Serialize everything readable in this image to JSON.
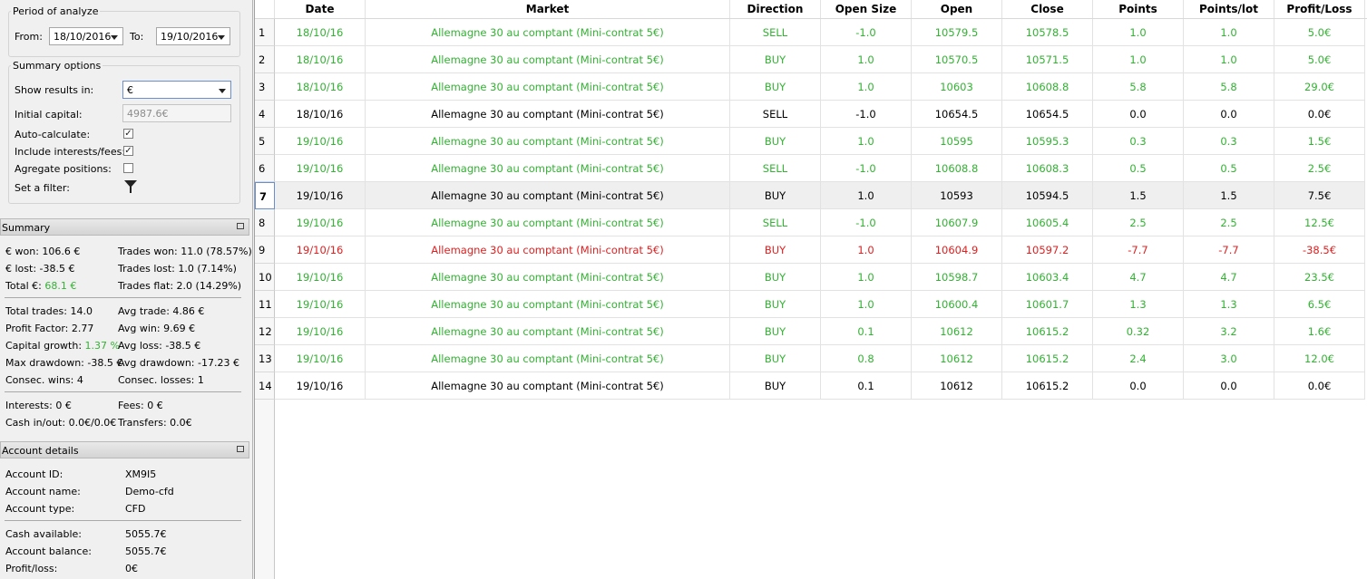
{
  "period": {
    "legend": "Period of analyze",
    "from_label": "From:",
    "from_value": "18/10/2016",
    "to_label": "To:",
    "to_value": "19/10/2016"
  },
  "summary_options": {
    "legend": "Summary options",
    "show_results_label": "Show results in:",
    "show_results_value": "€",
    "initial_capital_label": "Initial capital:",
    "initial_capital_value": "4987.6€",
    "auto_calculate_label": "Auto-calculate:",
    "auto_calculate_checked": true,
    "include_fees_label": "Include interests/fees:",
    "include_fees_checked": true,
    "aggregate_label": "Agregate positions:",
    "aggregate_checked": false,
    "filter_label": "Set a filter:",
    "filter_icon": "funnel-icon",
    "check_mark": "✓"
  },
  "summary": {
    "title": "Summary",
    "won_label": "€ won:",
    "won_value": "106.6 €",
    "lost_label": "€ lost:",
    "lost_value": "-38.5 €",
    "total_label": "Total €:",
    "total_value": "68.1 €",
    "trades_won_label": "Trades won:",
    "trades_won_value": "11.0 (78.57%)",
    "trades_lost_label": "Trades lost:",
    "trades_lost_value": "1.0 (7.14%)",
    "trades_flat_label": "Trades flat:",
    "trades_flat_value": "2.0 (14.29%)",
    "total_trades_label": "Total trades:",
    "total_trades_value": "14.0",
    "profit_factor_label": "Profit Factor:",
    "profit_factor_value": "2.77",
    "capital_growth_label": "Capital growth:",
    "capital_growth_value": "1.37 %",
    "max_drawdown_label": "Max drawdown:",
    "max_drawdown_value": "-38.5 €",
    "consec_wins_label": "Consec. wins:",
    "consec_wins_value": "4",
    "avg_trade_label": "Avg trade:",
    "avg_trade_value": "4.86 €",
    "avg_win_label": "Avg win:",
    "avg_win_value": "9.69 €",
    "avg_loss_label": "Avg loss:",
    "avg_loss_value": "-38.5 €",
    "avg_drawdown_label": "Avg drawdown:",
    "avg_drawdown_value": "-17.23 €",
    "consec_losses_label": "Consec. losses:",
    "consec_losses_value": "1",
    "interests_label": "Interests:",
    "interests_value": "0 €",
    "fees_label": "Fees:",
    "fees_value": "0 €",
    "cash_label": "Cash in/out:",
    "cash_value": "0.0€/0.0€",
    "transfers_label": "Transfers:",
    "transfers_value": "0.0€"
  },
  "account": {
    "title": "Account details",
    "id_label": "Account ID:",
    "id_value": "XM9I5",
    "name_label": "Account name:",
    "name_value": "Demo-cfd",
    "type_label": "Account type:",
    "type_value": "CFD",
    "cash_label": "Cash available:",
    "cash_value": "5055.7€",
    "balance_label": "Account balance:",
    "balance_value": "5055.7€",
    "pl_label": "Profit/loss:",
    "pl_value": "0€"
  },
  "table": {
    "headers": [
      "Date",
      "Market",
      "Direction",
      "Open Size",
      "Open",
      "Close",
      "Points",
      "Points/lot",
      "Profit/Loss"
    ],
    "colors": {
      "green": "#33b233",
      "red": "#e02020",
      "black": "#000000"
    },
    "selected_row": 7,
    "rows": [
      {
        "n": "1",
        "date": "18/10/16",
        "market": "Allemagne 30 au comptant (Mini-contrat 5€)",
        "direction": "SELL",
        "size": "-1.0",
        "open": "10579.5",
        "close": "10578.5",
        "points": "1.0",
        "ppl": "1.0",
        "pl": "5.0€",
        "color": "green"
      },
      {
        "n": "2",
        "date": "18/10/16",
        "market": "Allemagne 30 au comptant (Mini-contrat 5€)",
        "direction": "BUY",
        "size": "1.0",
        "open": "10570.5",
        "close": "10571.5",
        "points": "1.0",
        "ppl": "1.0",
        "pl": "5.0€",
        "color": "green"
      },
      {
        "n": "3",
        "date": "18/10/16",
        "market": "Allemagne 30 au comptant (Mini-contrat 5€)",
        "direction": "BUY",
        "size": "1.0",
        "open": "10603",
        "close": "10608.8",
        "points": "5.8",
        "ppl": "5.8",
        "pl": "29.0€",
        "color": "green"
      },
      {
        "n": "4",
        "date": "18/10/16",
        "market": "Allemagne 30 au comptant (Mini-contrat 5€)",
        "direction": "SELL",
        "size": "-1.0",
        "open": "10654.5",
        "close": "10654.5",
        "points": "0.0",
        "ppl": "0.0",
        "pl": "0.0€",
        "color": "black"
      },
      {
        "n": "5",
        "date": "19/10/16",
        "market": "Allemagne 30 au comptant (Mini-contrat 5€)",
        "direction": "BUY",
        "size": "1.0",
        "open": "10595",
        "close": "10595.3",
        "points": "0.3",
        "ppl": "0.3",
        "pl": "1.5€",
        "color": "green"
      },
      {
        "n": "6",
        "date": "19/10/16",
        "market": "Allemagne 30 au comptant (Mini-contrat 5€)",
        "direction": "SELL",
        "size": "-1.0",
        "open": "10608.8",
        "close": "10608.3",
        "points": "0.5",
        "ppl": "0.5",
        "pl": "2.5€",
        "color": "green"
      },
      {
        "n": "7",
        "date": "19/10/16",
        "market": "Allemagne 30 au comptant (Mini-contrat 5€)",
        "direction": "BUY",
        "size": "1.0",
        "open": "10593",
        "close": "10594.5",
        "points": "1.5",
        "ppl": "1.5",
        "pl": "7.5€",
        "color": "black"
      },
      {
        "n": "8",
        "date": "19/10/16",
        "market": "Allemagne 30 au comptant (Mini-contrat 5€)",
        "direction": "SELL",
        "size": "-1.0",
        "open": "10607.9",
        "close": "10605.4",
        "points": "2.5",
        "ppl": "2.5",
        "pl": "12.5€",
        "color": "green"
      },
      {
        "n": "9",
        "date": "19/10/16",
        "market": "Allemagne 30 au comptant (Mini-contrat 5€)",
        "direction": "BUY",
        "size": "1.0",
        "open": "10604.9",
        "close": "10597.2",
        "points": "-7.7",
        "ppl": "-7.7",
        "pl": "-38.5€",
        "color": "red"
      },
      {
        "n": "10",
        "date": "19/10/16",
        "market": "Allemagne 30 au comptant (Mini-contrat 5€)",
        "direction": "BUY",
        "size": "1.0",
        "open": "10598.7",
        "close": "10603.4",
        "points": "4.7",
        "ppl": "4.7",
        "pl": "23.5€",
        "color": "green"
      },
      {
        "n": "11",
        "date": "19/10/16",
        "market": "Allemagne 30 au comptant (Mini-contrat 5€)",
        "direction": "BUY",
        "size": "1.0",
        "open": "10600.4",
        "close": "10601.7",
        "points": "1.3",
        "ppl": "1.3",
        "pl": "6.5€",
        "color": "green"
      },
      {
        "n": "12",
        "date": "19/10/16",
        "market": "Allemagne 30 au comptant (Mini-contrat 5€)",
        "direction": "BUY",
        "size": "0.1",
        "open": "10612",
        "close": "10615.2",
        "points": "0.32",
        "ppl": "3.2",
        "pl": "1.6€",
        "color": "green"
      },
      {
        "n": "13",
        "date": "19/10/16",
        "market": "Allemagne 30 au comptant (Mini-contrat 5€)",
        "direction": "BUY",
        "size": "0.8",
        "open": "10612",
        "close": "10615.2",
        "points": "2.4",
        "ppl": "3.0",
        "pl": "12.0€",
        "color": "green"
      },
      {
        "n": "14",
        "date": "19/10/16",
        "market": "Allemagne 30 au comptant (Mini-contrat 5€)",
        "direction": "BUY",
        "size": "0.1",
        "open": "10612",
        "close": "10615.2",
        "points": "0.0",
        "ppl": "0.0",
        "pl": "0.0€",
        "color": "black"
      }
    ]
  }
}
